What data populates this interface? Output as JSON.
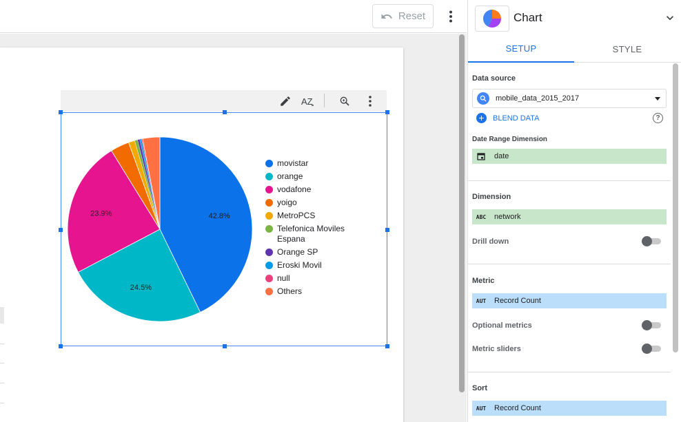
{
  "toolbar": {
    "reset_label": "Reset"
  },
  "chart_data": {
    "type": "pie",
    "title": "",
    "categories": [
      "movistar",
      "orange",
      "vodafone",
      "yoigo",
      "MetroPCS",
      "Telefonica Moviles Espana",
      "Orange SP",
      "Eroski Movil",
      "null",
      "Others"
    ],
    "values": [
      42.8,
      24.5,
      23.9,
      3.3,
      1.1,
      0.5,
      0.4,
      0.3,
      0.2,
      3.0
    ],
    "data_labels": [
      "42.8%",
      "24.5%",
      "23.9%",
      "",
      "",
      "",
      "",
      "",
      "",
      ""
    ],
    "colors": [
      "#0b72ea",
      "#00b7c8",
      "#e6148f",
      "#f26b00",
      "#f2a900",
      "#7cb342",
      "#5e35b1",
      "#039be5",
      "#ec407a",
      "#ff7043"
    ],
    "legend": {
      "placement": "right",
      "items": [
        "movistar",
        "orange",
        "vodafone",
        "yoigo",
        "MetroPCS",
        "Telefonica Moviles Espana",
        "Orange SP",
        "Eroski Movil",
        "null",
        "Others"
      ]
    }
  },
  "chart_toolbar": {
    "icons": [
      "pencil-icon",
      "sort-az-icon",
      "zoom-icon",
      "more-vert-icon"
    ],
    "sort_label": "AZ"
  },
  "panel": {
    "title": "Chart",
    "tabs": [
      {
        "label": "SETUP",
        "active": true
      },
      {
        "label": "STYLE",
        "active": false
      }
    ],
    "data_source": {
      "label": "Data source",
      "value": "mobile_data_2015_2017",
      "blend_label": "BLEND DATA",
      "help": "?"
    },
    "date_range": {
      "label": "Date Range Dimension",
      "value": "date"
    },
    "dimension": {
      "label": "Dimension",
      "value": "network",
      "type_code": "ABC"
    },
    "drill_down": {
      "label": "Drill down",
      "on": false
    },
    "metric": {
      "label": "Metric",
      "value": "Record Count",
      "type_code": "AUT"
    },
    "optional_metrics": {
      "label": "Optional metrics",
      "on": false
    },
    "metric_sliders": {
      "label": "Metric sliders",
      "on": false
    },
    "sort": {
      "label": "Sort",
      "value": "Record Count",
      "type_code": "AUT"
    }
  }
}
